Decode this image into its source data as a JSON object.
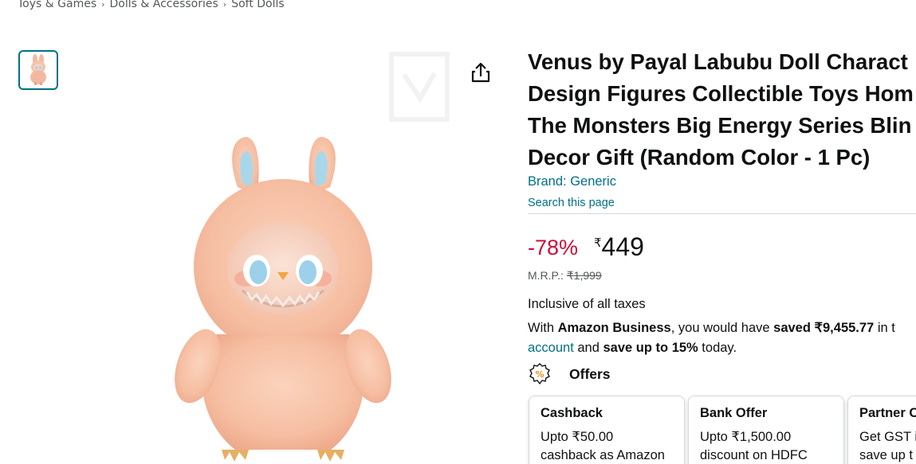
{
  "breadcrumb": {
    "items": [
      "Toys & Games",
      "Dolls & Accessories",
      "Soft Dolls"
    ],
    "separator": "›"
  },
  "product": {
    "title_lines": [
      "Venus by Payal Labubu Doll Charact",
      "Design Figures Collectible Toys Hom",
      "The Monsters Big Energy Series Blin",
      "Decor Gift (Random Color - 1 Pc)"
    ],
    "brand_link": "Brand: Generic",
    "search_page": "Search this page"
  },
  "pricing": {
    "discount": "-78%",
    "currency_symbol": "₹",
    "price": "449",
    "mrp_label": "M.R.P.:",
    "mrp_value": "₹1,999",
    "taxes": "Inclusive of all taxes"
  },
  "business": {
    "part1": "With ",
    "bold1": "Amazon Business",
    "part2": ", you would have ",
    "bold2": "saved ₹9,455.77",
    "part3": " in t",
    "link": "account",
    "part4": " and ",
    "bold3": "save up to 15%",
    "part5": " today."
  },
  "offers": {
    "heading": "Offers",
    "cards": [
      {
        "title": "Cashback",
        "line1": "Upto ₹50.00",
        "line2": "cashback as Amazon"
      },
      {
        "title": "Bank Offer",
        "line1": "Upto ₹1,500.00",
        "line2": "discount on HDFC"
      },
      {
        "title": "Partner C",
        "line1": "Get GST i",
        "line2": "save up t"
      }
    ]
  },
  "colors": {
    "link": "#007185",
    "discount": "#cc0c39",
    "text": "#0f1111",
    "muted": "#565959",
    "doll_fur": "#f8c4a8"
  },
  "icons": {
    "share": "share-icon",
    "offers": "offer-percent-icon"
  }
}
